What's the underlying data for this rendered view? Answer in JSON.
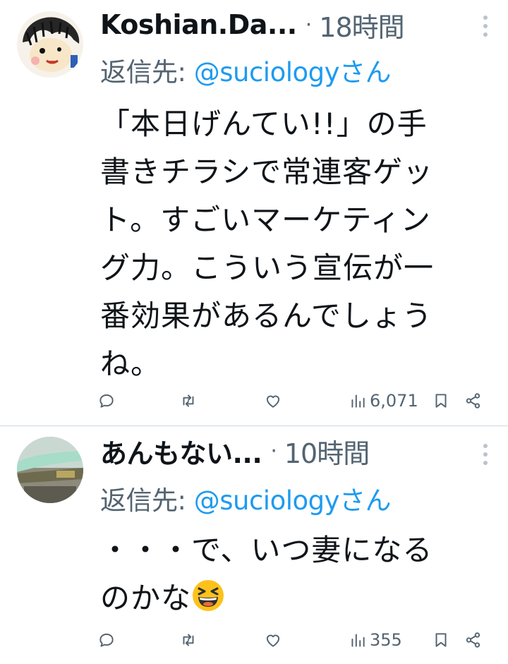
{
  "tweets": [
    {
      "author": "Koshian.Da...",
      "separator": "·",
      "time": "18時間",
      "reply_prefix": "返信先: ",
      "reply_handle": "@suciologyさん",
      "body_lines": [
        "「本日げんてい!!」の手",
        "書きチラシで常連客ゲッ",
        "ト。すごいマーケティン",
        "グ力。こういう宣伝が一",
        "番効果があるんでしょう",
        "ね。"
      ],
      "views": "6,071"
    },
    {
      "author": "あんもない...",
      "separator": "·",
      "time": "10時間",
      "reply_prefix": "返信先: ",
      "reply_handle": "@suciologyさん",
      "body_lines": [
        "・・・で、いつ妻になる",
        "のかな"
      ],
      "emoji": "grinning-squinting-face",
      "views": "355"
    }
  ],
  "colors": {
    "text": "#0f1419",
    "secondary": "#536471",
    "link": "#1d9bf0",
    "divider": "#cfd9de"
  },
  "icons": [
    "reply-icon",
    "retweet-icon",
    "like-icon",
    "views-icon",
    "bookmark-icon",
    "share-icon",
    "more-icon"
  ]
}
